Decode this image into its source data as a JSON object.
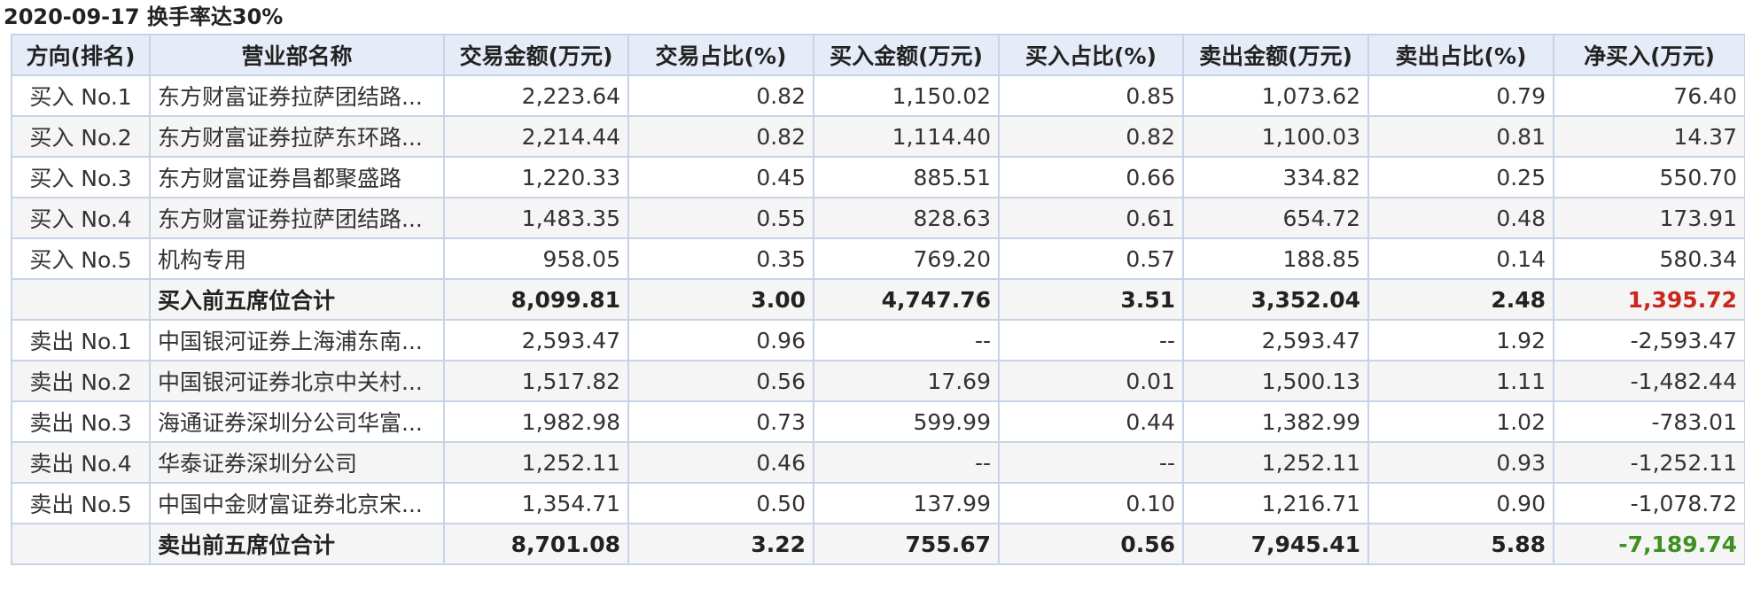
{
  "title": "2020-09-17 换手率达30%",
  "colors": {
    "positive": "#d22c2c",
    "negative": "#4f9d2f",
    "header_bg": "#e5ecf7",
    "border": "#c7d4e8"
  },
  "columns": [
    "方向(排名)",
    "营业部名称",
    "交易金额(万元)",
    "交易占比(%)",
    "买入金额(万元)",
    "买入占比(%)",
    "卖出金额(万元)",
    "卖出占比(%)",
    "净买入(万元)"
  ],
  "rows": [
    {
      "dir": "买入 No.1",
      "name": "东方财富证券拉萨团结路...",
      "amount": "2,223.64",
      "amount_pct": "0.82",
      "buy": "1,150.02",
      "buy_pct": "0.85",
      "sell": "1,073.62",
      "sell_pct": "0.79",
      "net": "76.40"
    },
    {
      "dir": "买入 No.2",
      "name": "东方财富证券拉萨东环路...",
      "amount": "2,214.44",
      "amount_pct": "0.82",
      "buy": "1,114.40",
      "buy_pct": "0.82",
      "sell": "1,100.03",
      "sell_pct": "0.81",
      "net": "14.37"
    },
    {
      "dir": "买入 No.3",
      "name": "东方财富证券昌都聚盛路",
      "amount": "1,220.33",
      "amount_pct": "0.45",
      "buy": "885.51",
      "buy_pct": "0.66",
      "sell": "334.82",
      "sell_pct": "0.25",
      "net": "550.70"
    },
    {
      "dir": "买入 No.4",
      "name": "东方财富证券拉萨团结路...",
      "amount": "1,483.35",
      "amount_pct": "0.55",
      "buy": "828.63",
      "buy_pct": "0.61",
      "sell": "654.72",
      "sell_pct": "0.48",
      "net": "173.91"
    },
    {
      "dir": "买入 No.5",
      "name": "机构专用",
      "amount": "958.05",
      "amount_pct": "0.35",
      "buy": "769.20",
      "buy_pct": "0.57",
      "sell": "188.85",
      "sell_pct": "0.14",
      "net": "580.34"
    },
    {
      "dir": "",
      "name": "买入前五席位合计",
      "amount": "8,099.81",
      "amount_pct": "3.00",
      "buy": "4,747.76",
      "buy_pct": "3.51",
      "sell": "3,352.04",
      "sell_pct": "2.48",
      "net": "1,395.72"
    },
    {
      "dir": "卖出 No.1",
      "name": "中国银河证券上海浦东南...",
      "amount": "2,593.47",
      "amount_pct": "0.96",
      "buy": "--",
      "buy_pct": "--",
      "sell": "2,593.47",
      "sell_pct": "1.92",
      "net": "-2,593.47"
    },
    {
      "dir": "卖出 No.2",
      "name": "中国银河证券北京中关村...",
      "amount": "1,517.82",
      "amount_pct": "0.56",
      "buy": "17.69",
      "buy_pct": "0.01",
      "sell": "1,500.13",
      "sell_pct": "1.11",
      "net": "-1,482.44"
    },
    {
      "dir": "卖出 No.3",
      "name": "海通证券深圳分公司华富...",
      "amount": "1,982.98",
      "amount_pct": "0.73",
      "buy": "599.99",
      "buy_pct": "0.44",
      "sell": "1,382.99",
      "sell_pct": "1.02",
      "net": "-783.01"
    },
    {
      "dir": "卖出 No.4",
      "name": "华泰证券深圳分公司",
      "amount": "1,252.11",
      "amount_pct": "0.46",
      "buy": "--",
      "buy_pct": "--",
      "sell": "1,252.11",
      "sell_pct": "0.93",
      "net": "-1,252.11"
    },
    {
      "dir": "卖出 No.5",
      "name": "中国中金财富证券北京宋...",
      "amount": "1,354.71",
      "amount_pct": "0.50",
      "buy": "137.99",
      "buy_pct": "0.10",
      "sell": "1,216.71",
      "sell_pct": "0.90",
      "net": "-1,078.72"
    },
    {
      "dir": "",
      "name": "卖出前五席位合计",
      "amount": "8,701.08",
      "amount_pct": "3.22",
      "buy": "755.67",
      "buy_pct": "0.56",
      "sell": "7,945.41",
      "sell_pct": "5.88",
      "net": "-7,189.74"
    }
  ]
}
